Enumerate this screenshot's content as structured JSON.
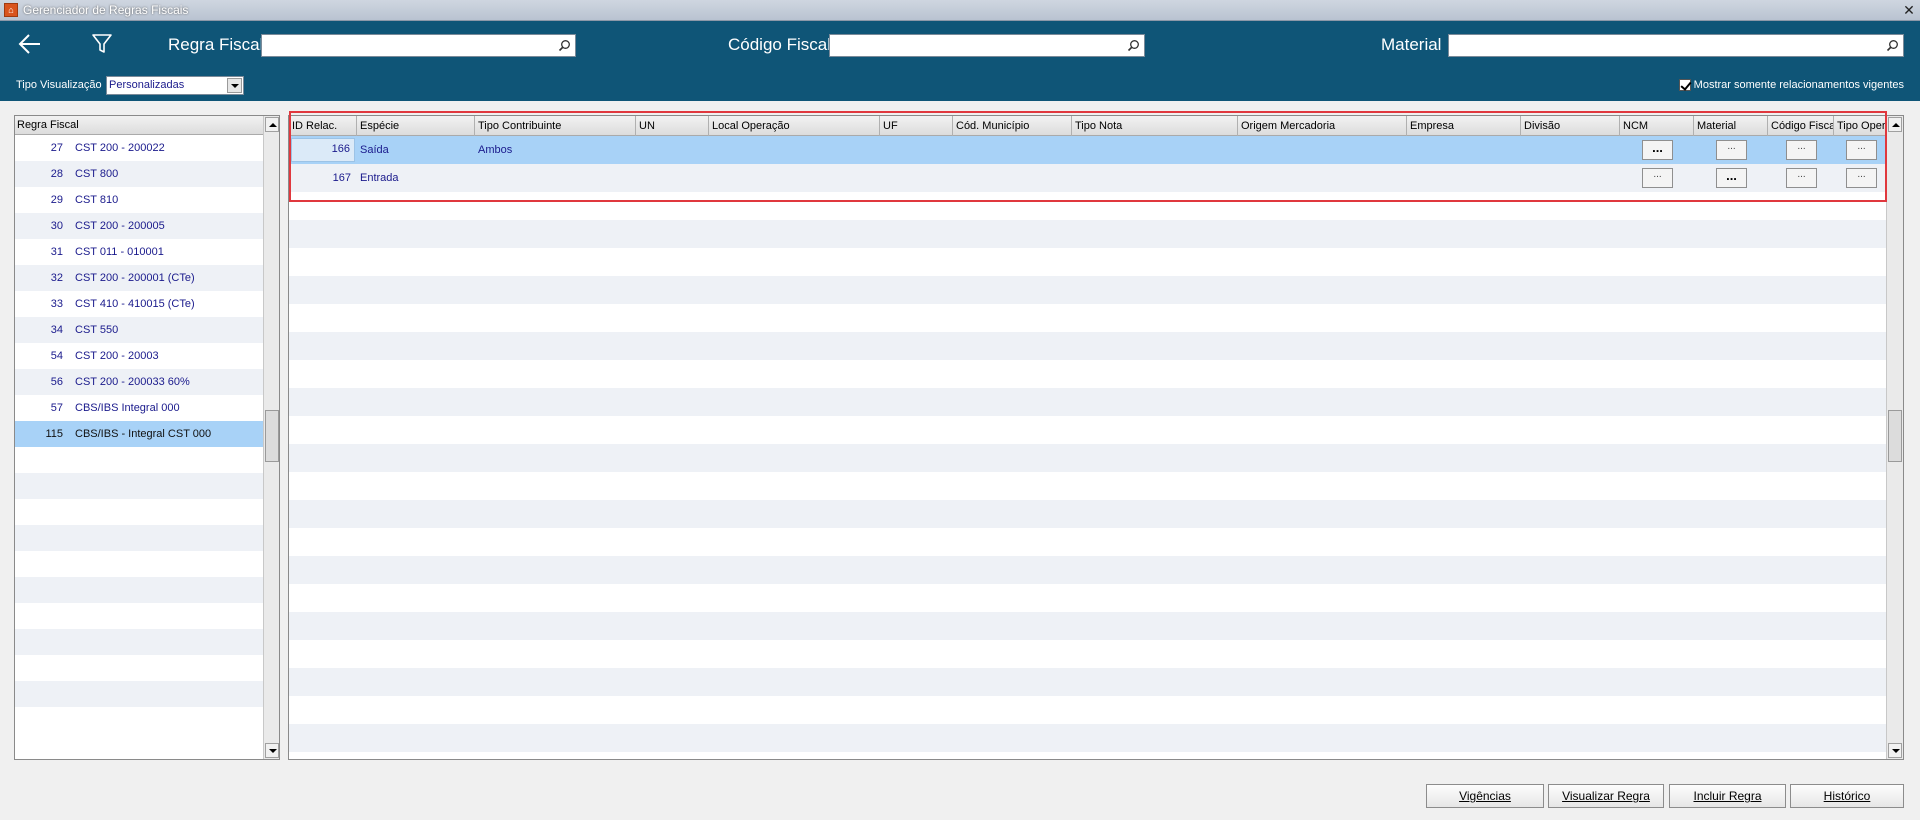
{
  "window": {
    "title": "Gerenciador de Regras Fiscais",
    "close": "✕"
  },
  "header": {
    "regra_fiscal_label": "Regra Fiscal",
    "regra_fiscal_value": "",
    "codigo_fiscal_label": "Código Fiscal",
    "codigo_fiscal_value": "",
    "material_label": "Material",
    "material_value": "",
    "tipo_visualizacao_label": "Tipo Visualização",
    "tipo_visualizacao_value": "Personalizadas",
    "vigentes_label": "Mostrar somente relacionamentos vigentes",
    "vigentes_checked": true,
    "colors": {
      "band": "#0f5577"
    }
  },
  "left_list": {
    "header": "Regra Fiscal",
    "rows": [
      {
        "num": "27",
        "label": "CST 200 - 200022"
      },
      {
        "num": "28",
        "label": "CST 800"
      },
      {
        "num": "29",
        "label": "CST 810"
      },
      {
        "num": "30",
        "label": "CST 200 - 200005"
      },
      {
        "num": "31",
        "label": "CST 011 - 010001"
      },
      {
        "num": "32",
        "label": "CST 200 - 200001 (CTe)"
      },
      {
        "num": "33",
        "label": "CST 410 - 410015 (CTe)"
      },
      {
        "num": "34",
        "label": "CST 550"
      },
      {
        "num": "54",
        "label": "CST 200 - 20003"
      },
      {
        "num": "56",
        "label": "CST 200 - 200033 60%"
      },
      {
        "num": "57",
        "label": "CBS/IBS Integral 000"
      },
      {
        "num": "115",
        "label": "CBS/IBS - Integral CST 000"
      }
    ],
    "selected_index": 11
  },
  "grid": {
    "columns": [
      "ID Relac.",
      "Espécie",
      "Tipo Contribuinte",
      "UN",
      "Local Operação",
      "UF",
      "Cód. Município",
      "Tipo Nota",
      "Origem Mercadoria",
      "Empresa",
      "Divisão",
      "NCM",
      "Material",
      "Código Fiscal",
      "Tipo Oper."
    ],
    "rows": [
      {
        "id": "166",
        "especie": "Saída",
        "tipo_contribuinte": "Ambos",
        "ncm": "...",
        "material": "...",
        "codigo_fiscal": "...",
        "tipo_oper": "...",
        "bold": [
          "ncm"
        ]
      },
      {
        "id": "167",
        "especie": "Entrada",
        "tipo_contribuinte": "",
        "ncm": "...",
        "material": "...",
        "codigo_fiscal": "...",
        "tipo_oper": "...",
        "bold": [
          "material"
        ]
      }
    ],
    "selected_index": 0,
    "highlight_color": "#e0383e"
  },
  "buttons": {
    "vigencias": "Vigências",
    "visualizar_regra": "Visualizar Regra",
    "incluir_regra": "Incluir Regra",
    "historico": "Histórico"
  },
  "icons": [
    "app-icon",
    "back-arrow-icon",
    "filter-icon",
    "search-icon",
    "checkbox-icon",
    "dropdown-arrow-icon",
    "close-icon"
  ]
}
